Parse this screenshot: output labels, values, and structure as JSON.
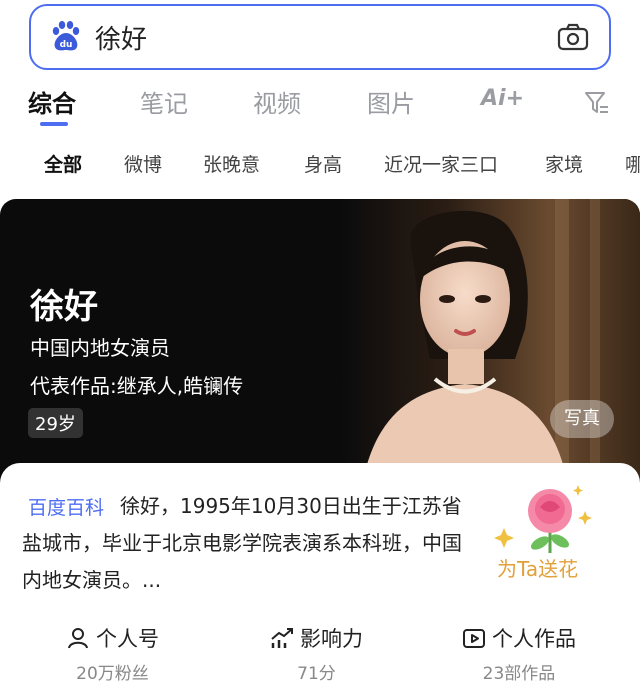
{
  "search": {
    "query": "徐好"
  },
  "tabs": [
    "综合",
    "笔记",
    "视频",
    "图片"
  ],
  "ai_label": "Ai+",
  "subtabs": [
    "全部",
    "微博",
    "张晚意",
    "身高",
    "近况一家三口",
    "家境",
    "哪"
  ],
  "hero": {
    "name": "徐好",
    "description": "中国内地女演员",
    "works": "代表作品:继承人,皓镧传",
    "age": "29岁",
    "photo_button": "写真"
  },
  "card": {
    "source": "百度百科",
    "intro": "徐好，1995年10月30日出生于江苏省盐城市，毕业于北京电影学院表演系本科班，中国内地女演员。...",
    "flower_label": "为Ta送花",
    "stats": [
      {
        "title": "个人号",
        "sub": "20万粉丝",
        "icon": "person-icon"
      },
      {
        "title": "影响力",
        "sub": "71分",
        "icon": "trend-icon"
      },
      {
        "title": "个人作品",
        "sub": "23部作品",
        "icon": "play-icon"
      }
    ]
  },
  "colors": {
    "accent": "#4e6ef2",
    "flower_text": "#e3a03a"
  }
}
